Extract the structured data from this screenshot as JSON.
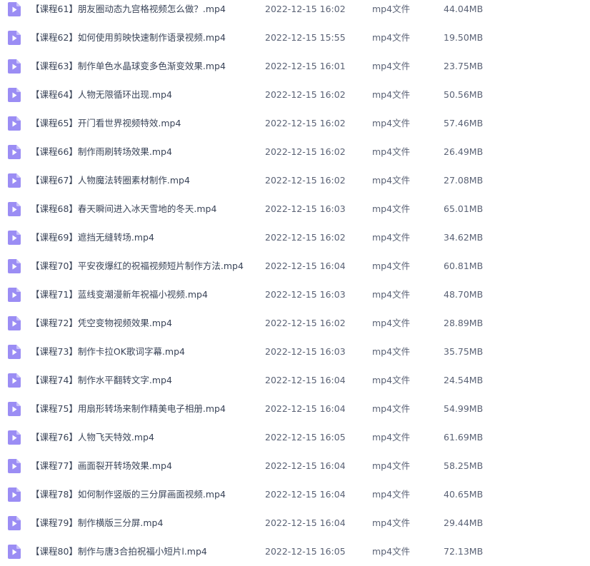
{
  "colors": {
    "icon_fill": "#9b8df4",
    "icon_play": "#ffffff",
    "text": "#3a4458"
  },
  "file_icon": "video-file-icon",
  "files": [
    {
      "name": "【课程61】朋友圈动态九宫格视频怎么做？.mp4",
      "modified": "2022-12-15 16:02",
      "type": "mp4文件",
      "size": "44.04MB"
    },
    {
      "name": "【课程62】如何使用剪映快速制作语录视频.mp4",
      "modified": "2022-12-15 15:55",
      "type": "mp4文件",
      "size": "19.50MB"
    },
    {
      "name": "【课程63】制作单色水晶球变多色渐变效果.mp4",
      "modified": "2022-12-15 16:01",
      "type": "mp4文件",
      "size": "23.75MB"
    },
    {
      "name": "【课程64】人物无限循环出现.mp4",
      "modified": "2022-12-15 16:02",
      "type": "mp4文件",
      "size": "50.56MB"
    },
    {
      "name": "【课程65】开门看世界视频特效.mp4",
      "modified": "2022-12-15 16:02",
      "type": "mp4文件",
      "size": "57.46MB"
    },
    {
      "name": "【课程66】制作雨刷转场效果.mp4",
      "modified": "2022-12-15 16:02",
      "type": "mp4文件",
      "size": "26.49MB"
    },
    {
      "name": "【课程67】人物魔法转圈素材制作.mp4",
      "modified": "2022-12-15 16:02",
      "type": "mp4文件",
      "size": "27.08MB"
    },
    {
      "name": "【课程68】春天瞬间进入冰天雪地的冬天.mp4",
      "modified": "2022-12-15 16:03",
      "type": "mp4文件",
      "size": "65.01MB"
    },
    {
      "name": "【课程69】遮挡无缝转场.mp4",
      "modified": "2022-12-15 16:02",
      "type": "mp4文件",
      "size": "34.62MB"
    },
    {
      "name": "【课程70】平安夜爆红的祝福视频短片制作方法.mp4",
      "modified": "2022-12-15 16:04",
      "type": "mp4文件",
      "size": "60.81MB"
    },
    {
      "name": "【课程71】蓝线变潮漫新年祝福小视频.mp4",
      "modified": "2022-12-15 16:03",
      "type": "mp4文件",
      "size": "48.70MB"
    },
    {
      "name": "【课程72】凭空变物视频效果.mp4",
      "modified": "2022-12-15 16:02",
      "type": "mp4文件",
      "size": "28.89MB"
    },
    {
      "name": "【课程73】制作卡拉OK歌词字幕.mp4",
      "modified": "2022-12-15 16:03",
      "type": "mp4文件",
      "size": "35.75MB"
    },
    {
      "name": "【课程74】制作水平翻转文字.mp4",
      "modified": "2022-12-15 16:04",
      "type": "mp4文件",
      "size": "24.54MB"
    },
    {
      "name": "【课程75】用扇形转场来制作精美电子相册.mp4",
      "modified": "2022-12-15 16:04",
      "type": "mp4文件",
      "size": "54.99MB"
    },
    {
      "name": "【课程76】人物飞天特效.mp4",
      "modified": "2022-12-15 16:05",
      "type": "mp4文件",
      "size": "61.69MB"
    },
    {
      "name": "【课程77】画面裂开转场效果.mp4",
      "modified": "2022-12-15 16:04",
      "type": "mp4文件",
      "size": "58.25MB"
    },
    {
      "name": "【课程78】如何制作竖版的三分屏画面视频.mp4",
      "modified": "2022-12-15 16:04",
      "type": "mp4文件",
      "size": "40.65MB"
    },
    {
      "name": "【课程79】制作横版三分屏.mp4",
      "modified": "2022-12-15 16:04",
      "type": "mp4文件",
      "size": "29.44MB"
    },
    {
      "name": "【课程80】制作与唐3合拍祝福小短片l.mp4",
      "modified": "2022-12-15 16:05",
      "type": "mp4文件",
      "size": "72.13MB"
    }
  ]
}
